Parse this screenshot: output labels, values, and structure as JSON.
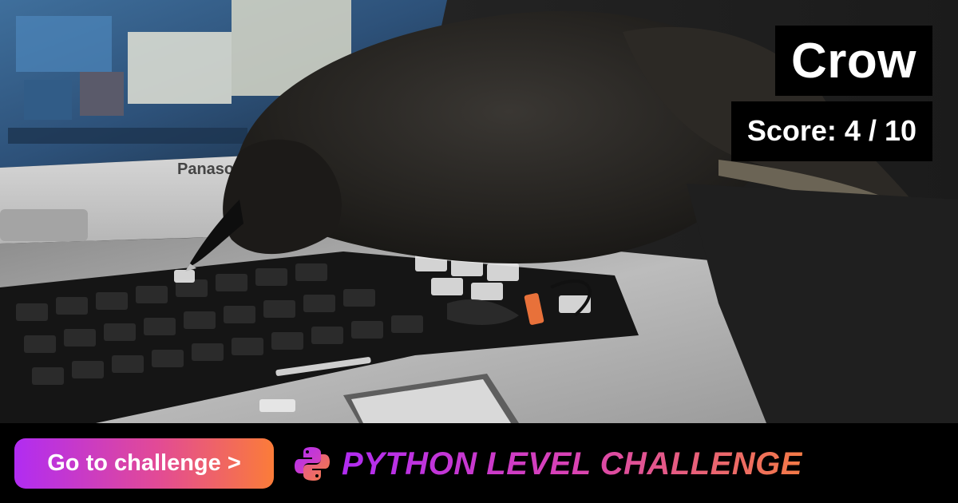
{
  "card": {
    "title": "Crow",
    "score_label": "Score: 4 / 10"
  },
  "photo": {
    "subject": "crow-on-laptop-keyboard",
    "laptop_brand_text": "Panaso"
  },
  "footer": {
    "cta_label": "Go to challenge >",
    "brand_text": "PYTHON LEVEL CHALLENGE",
    "brand_icon": "python-logo-icon",
    "colors": {
      "gradient_start": "#b12cf2",
      "gradient_mid": "#e24a96",
      "gradient_end": "#fb7c39",
      "background": "#000000",
      "text": "#ffffff"
    }
  }
}
